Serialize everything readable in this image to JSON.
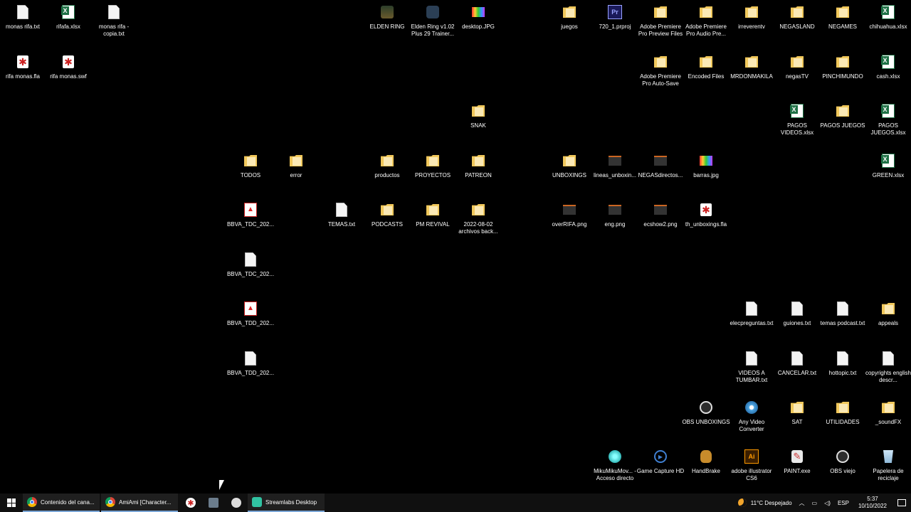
{
  "desktop": {
    "icons": [
      {
        "label": "monas rifa.txt",
        "icon": "text-file-icon"
      },
      {
        "label": "rifafa.xlsx",
        "icon": "excel-file-icon"
      },
      {
        "label": "monas rifa - copia.txt",
        "icon": "text-file-icon"
      },
      {
        "label": "ELDEN RING",
        "icon": "game-shortcut-icon"
      },
      {
        "label": "Elden Ring v1.02 Plus 29 Trainer...",
        "icon": "app-shortcut-icon"
      },
      {
        "label": "desktop.JPG",
        "icon": "image-file-icon"
      },
      {
        "label": "juegos",
        "icon": "folder-icon"
      },
      {
        "label": "720_1.prproj",
        "icon": "premiere-project-icon"
      },
      {
        "label": "Adobe Premiere Pro Preview Files",
        "icon": "folder-icon"
      },
      {
        "label": "Adobe Premiere Pro Audio Pre...",
        "icon": "folder-icon"
      },
      {
        "label": "irreverentv",
        "icon": "folder-icon"
      },
      {
        "label": "NEGASLAND",
        "icon": "folder-icon"
      },
      {
        "label": "NEGAMES",
        "icon": "folder-icon"
      },
      {
        "label": "chihuahua.xlsx",
        "icon": "excel-file-icon"
      },
      {
        "label": "rifa monas.fla",
        "icon": "flash-file-icon"
      },
      {
        "label": "rifa monas.swf",
        "icon": "flash-file-icon"
      },
      {
        "label": "Adobe Premiere Pro Auto-Save",
        "icon": "folder-icon"
      },
      {
        "label": "Encoded Files",
        "icon": "folder-icon"
      },
      {
        "label": "MRDONMAKILA",
        "icon": "folder-icon"
      },
      {
        "label": "negasTV",
        "icon": "folder-icon"
      },
      {
        "label": "PINCHIMUNDO",
        "icon": "folder-icon"
      },
      {
        "label": "cash.xlsx",
        "icon": "excel-file-icon"
      },
      {
        "label": "SNAK",
        "icon": "folder-icon"
      },
      {
        "label": "PAGOS VIDEOS.xlsx",
        "icon": "excel-file-icon"
      },
      {
        "label": "PAGOS JUEGOS",
        "icon": "folder-icon"
      },
      {
        "label": "PAGOS JUEGOS.xlsx",
        "icon": "excel-file-icon"
      },
      {
        "label": "TODOS",
        "icon": "folder-icon"
      },
      {
        "label": "error",
        "icon": "folder-icon"
      },
      {
        "label": "productos",
        "icon": "folder-icon"
      },
      {
        "label": "PROYECTOS",
        "icon": "folder-icon"
      },
      {
        "label": "PATREON",
        "icon": "folder-icon"
      },
      {
        "label": "UNBOXINGS",
        "icon": "folder-icon"
      },
      {
        "label": "lineas_unboxin...",
        "icon": "dark-image-icon"
      },
      {
        "label": "NEGASdirectos...",
        "icon": "dark-image-icon"
      },
      {
        "label": "barras.jpg",
        "icon": "image-file-icon"
      },
      {
        "label": "GREEN.xlsx",
        "icon": "excel-file-icon"
      },
      {
        "label": "BBVA_TDC_202...",
        "icon": "pdf-file-icon"
      },
      {
        "label": "TEMAS.txt",
        "icon": "text-file-icon"
      },
      {
        "label": "PODCASTS",
        "icon": "folder-icon"
      },
      {
        "label": "PM REVIVAL",
        "icon": "folder-icon"
      },
      {
        "label": "2022-08-02 archivos back...",
        "icon": "folder-icon"
      },
      {
        "label": "overRIFA.png",
        "icon": "dark-image-icon"
      },
      {
        "label": "eng.png",
        "icon": "dark-image-icon"
      },
      {
        "label": "ecshow2.png",
        "icon": "dark-image-icon"
      },
      {
        "label": "th_unboxings.fla",
        "icon": "flash-file-icon"
      },
      {
        "label": "BBVA_TDC_202...",
        "icon": "text-file-icon"
      },
      {
        "label": "BBVA_TDD_202...",
        "icon": "pdf-file-icon"
      },
      {
        "label": "elecpreguntas.txt",
        "icon": "text-file-icon"
      },
      {
        "label": "guiones.txt",
        "icon": "text-file-icon"
      },
      {
        "label": "temas podcast.txt",
        "icon": "text-file-icon"
      },
      {
        "label": "appeals",
        "icon": "folder-icon"
      },
      {
        "label": "BBVA_TDD_202...",
        "icon": "text-file-icon"
      },
      {
        "label": "VIDEOS A TUMBAR.txt",
        "icon": "text-file-icon"
      },
      {
        "label": "CANCELAR.txt",
        "icon": "text-file-icon"
      },
      {
        "label": "hottopic.txt",
        "icon": "text-file-icon"
      },
      {
        "label": "copyrights english descr...",
        "icon": "text-file-icon"
      },
      {
        "label": "OBS UNBOXINGS",
        "icon": "obs-icon"
      },
      {
        "label": "Any Video Converter",
        "icon": "disc-app-icon"
      },
      {
        "label": "SAT",
        "icon": "folder-icon"
      },
      {
        "label": "UTILIDADES",
        "icon": "folder-icon"
      },
      {
        "label": "_soundFX",
        "icon": "folder-icon"
      },
      {
        "label": "MikuMikuMov... - Acceso directo",
        "icon": "miku-icon"
      },
      {
        "label": "Game Capture HD",
        "icon": "game-capture-icon"
      },
      {
        "label": "HandBrake",
        "icon": "handbrake-icon"
      },
      {
        "label": "adobe illustrator CS6",
        "icon": "illustrator-icon"
      },
      {
        "label": "PAINT.exe",
        "icon": "paint-icon"
      },
      {
        "label": "OBS viejo",
        "icon": "obs-icon"
      },
      {
        "label": "Papelera de reciclaje",
        "icon": "recycle-bin-icon"
      }
    ]
  },
  "taskbar": {
    "tasks": [
      {
        "label": "Contenido del cana...",
        "icon": "chrome-icon"
      },
      {
        "label": "AmiAmi [Character...",
        "icon": "chrome-icon"
      }
    ],
    "pinned": [
      {
        "icon": "flash-app-icon"
      },
      {
        "icon": "tools-app-icon"
      },
      {
        "icon": "paint-brush-app-icon"
      }
    ],
    "streamlabs_label": "Streamlabs Desktop",
    "weather": "11°C  Despejado",
    "language": "ESP",
    "time": "5:37",
    "date": "10/10/2022"
  }
}
